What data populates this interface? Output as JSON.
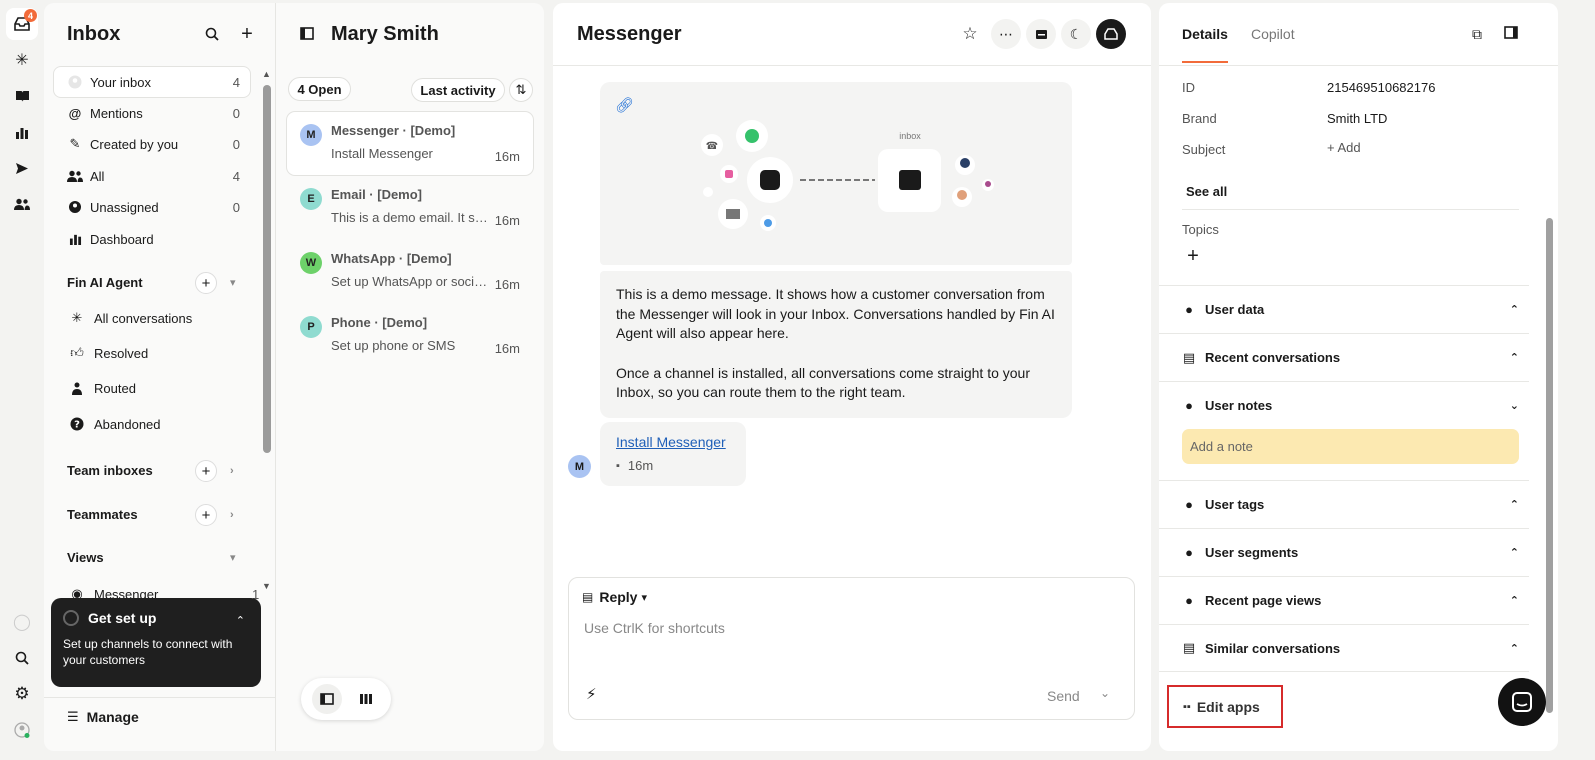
{
  "rail": {
    "badge": "4"
  },
  "inbox": {
    "title": "Inbox",
    "items": [
      {
        "label": "Your inbox",
        "count": "4"
      },
      {
        "label": "Mentions",
        "count": "0"
      },
      {
        "label": "Created by you",
        "count": "0"
      },
      {
        "label": "All",
        "count": "4"
      },
      {
        "label": "Unassigned",
        "count": "0"
      },
      {
        "label": "Dashboard",
        "count": ""
      }
    ],
    "fin_title": "Fin AI Agent",
    "fin_items": [
      "All conversations",
      "Resolved",
      "Routed",
      "Abandoned"
    ],
    "team_inboxes": "Team inboxes",
    "teammates": "Teammates",
    "views": "Views",
    "view_item": {
      "label": "Messenger",
      "count": "1"
    },
    "setup": {
      "title": "Get set up",
      "desc": "Set up channels to connect with your customers"
    },
    "manage": "Manage"
  },
  "list": {
    "title": "Mary Smith",
    "open_count": "4 Open",
    "sort": "Last activity",
    "items": [
      {
        "avatar": "M",
        "name": "Messenger · [Demo]",
        "preview": "Install Messenger",
        "time": "16m",
        "color": "#a9c3f2"
      },
      {
        "avatar": "E",
        "name": "Email · [Demo]",
        "preview": "This is a demo email. It shows how a customer",
        "time": "16m",
        "color": "#8fdbd0"
      },
      {
        "avatar": "W",
        "name": "WhatsApp · [Demo]",
        "preview": "Set up WhatsApp or social channels",
        "time": "16m",
        "color": "#6dd16a"
      },
      {
        "avatar": "P",
        "name": "Phone · [Demo]",
        "preview": "Set up phone or SMS",
        "time": "16m",
        "color": "#8fdbd0"
      }
    ]
  },
  "conversation": {
    "title": "Messenger",
    "illustration_label": "inbox",
    "message_p1": "This is a demo message. It shows how a customer conversation from the Messenger will look in your Inbox. Conversations handled by Fin AI Agent will also appear here.",
    "message_p2": "Once a channel is installed, all conversations come straight to your Inbox, so you can route them to the right team.",
    "link": "Install Messenger",
    "link_time": "16m",
    "sender_avatar": "M",
    "reply_label": "Reply",
    "reply_placeholder": "Use CtrlK for shortcuts",
    "send": "Send"
  },
  "details": {
    "tabs": [
      "Details",
      "Copilot"
    ],
    "rows": [
      {
        "label": "ID",
        "value": "215469510682176"
      },
      {
        "label": "Brand",
        "value": "Smith LTD"
      },
      {
        "label": "Subject",
        "value": "+ Add"
      }
    ],
    "see_all": "See all",
    "topics": "Topics",
    "sections": [
      "User data",
      "Recent conversations",
      "User notes"
    ],
    "note_placeholder": "Add a note",
    "sections2": [
      "User tags",
      "User segments",
      "Recent page views",
      "Similar conversations"
    ],
    "edit_apps": "Edit apps"
  },
  "colors": {
    "accent": "#f26b3a",
    "highlight": "#d62b2b",
    "note": "#fce9b1"
  }
}
